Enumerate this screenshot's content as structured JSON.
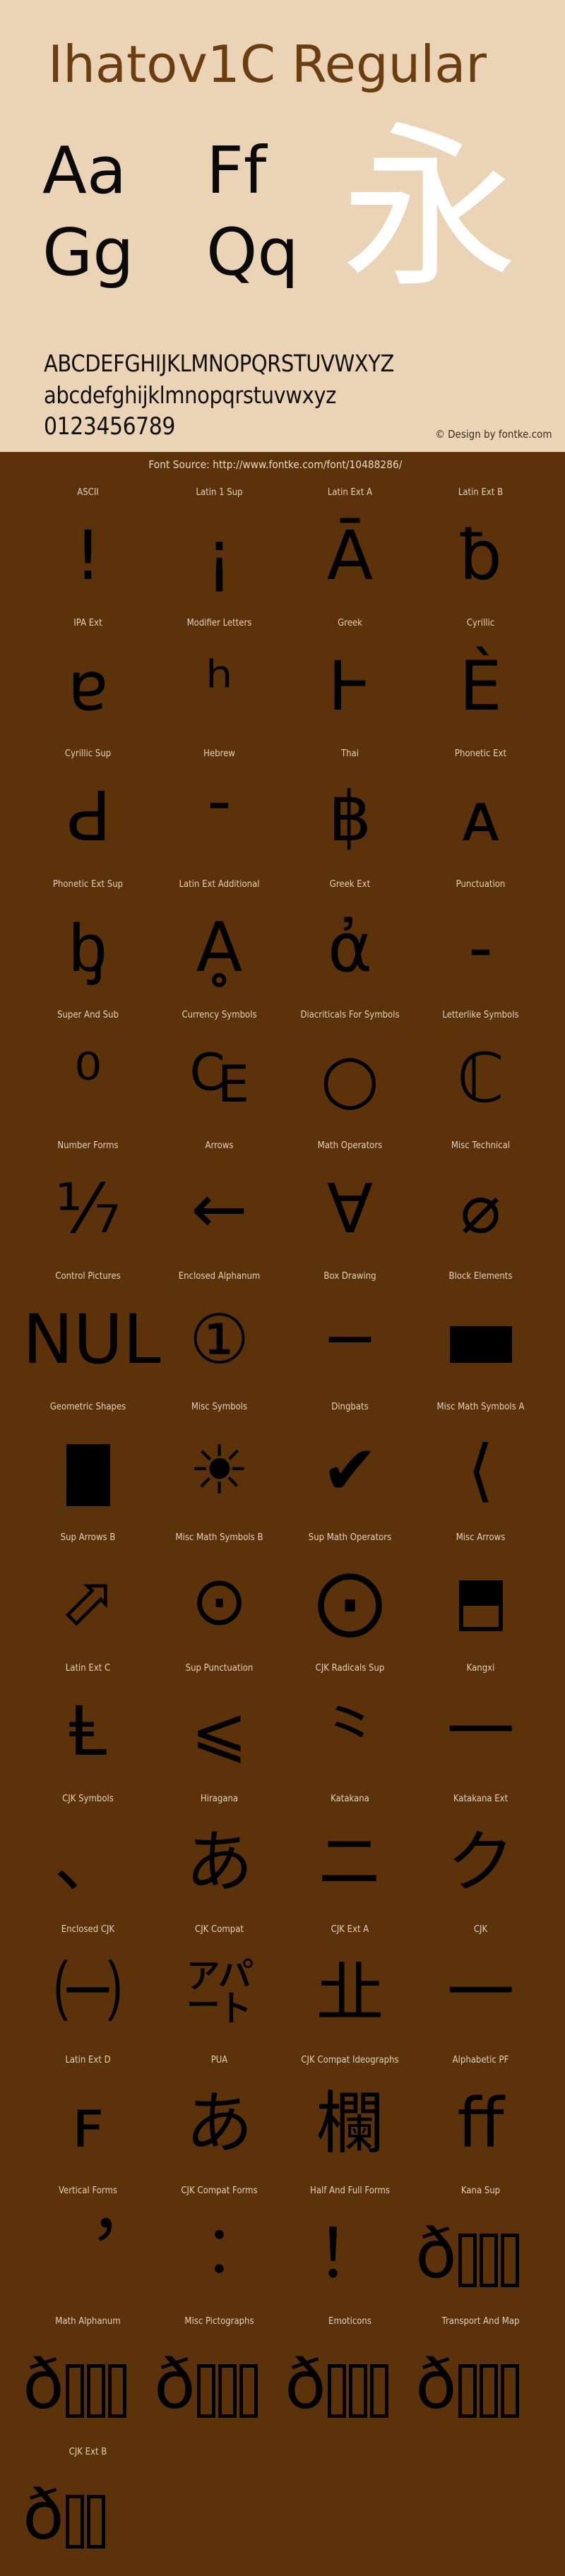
{
  "header": {
    "font_title": "Ihatov1C Regular",
    "sample_pairs": [
      "Aa",
      "Ff",
      "Gg",
      "Qq"
    ],
    "kanji_sample": "永",
    "alphabet_upper": "ABCDEFGHIJKLMNOPQRSTUVWXYZ",
    "alphabet_lower": "abcdefghijklmnopqrstuvwxyz",
    "digits": "0123456789",
    "credit": "© Design by fontke.com",
    "bg_color": "#ebd3b5",
    "title_color": "#6b3e12",
    "kanji_color": "#ffffff"
  },
  "source_line": "Font Source: http://www.fontke.com/font/10488286/",
  "page_bg_color": "#5b3209",
  "label_color": "#e3d2bd",
  "glyph_color": "#000000",
  "blocks": [
    {
      "label": "ASCII",
      "glyph": "!",
      "kind": "text"
    },
    {
      "label": "Latin 1 Sup",
      "glyph": "¡",
      "kind": "text"
    },
    {
      "label": "Latin Ext A",
      "glyph": "Ā",
      "kind": "text"
    },
    {
      "label": "Latin Ext B",
      "glyph": "ƀ",
      "kind": "text"
    },
    {
      "label": "IPA Ext",
      "glyph": "ɐ",
      "kind": "text"
    },
    {
      "label": "Modifier Letters",
      "glyph": "ʰ",
      "kind": "text"
    },
    {
      "label": "Greek",
      "glyph": "Ͱ",
      "kind": "text"
    },
    {
      "label": "Cyrillic",
      "glyph": "Ѐ",
      "kind": "text"
    },
    {
      "label": "Cyrillic Sup",
      "glyph": "Ԁ",
      "kind": "text"
    },
    {
      "label": "Hebrew",
      "glyph": "־",
      "kind": "text"
    },
    {
      "label": "Thai",
      "glyph": "฿",
      "kind": "text"
    },
    {
      "label": "Phonetic Ext",
      "glyph": "ᴀ",
      "kind": "text"
    },
    {
      "label": "Phonetic Ext Sup",
      "glyph": "ᶀ",
      "kind": "text"
    },
    {
      "label": "Latin Ext Additional",
      "glyph": "Ḁ",
      "kind": "text"
    },
    {
      "label": "Greek Ext",
      "glyph": "ἀ",
      "kind": "text"
    },
    {
      "label": "Punctuation",
      "glyph": "‐",
      "kind": "text"
    },
    {
      "label": "Super And Sub",
      "glyph": "⁰",
      "kind": "text"
    },
    {
      "label": "Currency Symbols",
      "glyph": "₠",
      "kind": "text"
    },
    {
      "label": "Diacriticals For Symbols",
      "glyph": "○",
      "kind": "text"
    },
    {
      "label": "Letterlike Symbols",
      "glyph": "ℂ",
      "kind": "text"
    },
    {
      "label": "Number Forms",
      "glyph": "⅐",
      "kind": "text"
    },
    {
      "label": "Arrows",
      "glyph": "←",
      "kind": "text"
    },
    {
      "label": "Math Operators",
      "glyph": "∀",
      "kind": "text"
    },
    {
      "label": "Misc Technical",
      "glyph": "⌀",
      "kind": "text"
    },
    {
      "label": "Control Pictures",
      "glyph": "NUL",
      "kind": "text"
    },
    {
      "label": "Enclosed Alphanum",
      "glyph": "①",
      "kind": "text"
    },
    {
      "label": "Box Drawing",
      "glyph": "─",
      "kind": "text"
    },
    {
      "label": "Block Elements",
      "glyph": "",
      "kind": "block-rect"
    },
    {
      "label": "Geometric Shapes",
      "glyph": "",
      "kind": "block-square"
    },
    {
      "label": "Misc Symbols",
      "glyph": "☀",
      "kind": "text"
    },
    {
      "label": "Dingbats",
      "glyph": "✔",
      "kind": "text"
    },
    {
      "label": "Misc Math Symbols A",
      "glyph": "⟨",
      "kind": "text"
    },
    {
      "label": "Sup Arrows B",
      "glyph": "⬀",
      "kind": "text"
    },
    {
      "label": "Misc Math Symbols B",
      "glyph": "⊙",
      "kind": "text"
    },
    {
      "label": "Sup Math Operators",
      "glyph": "⨀",
      "kind": "text"
    },
    {
      "label": "Misc Arrows",
      "glyph": "",
      "kind": "kangxi-box"
    },
    {
      "label": "Latin Ext C",
      "glyph": "Ⱡ",
      "kind": "text"
    },
    {
      "label": "Sup Punctuation",
      "glyph": "⩽",
      "kind": "text"
    },
    {
      "label": "CJK Radicals Sup",
      "glyph": "⺀",
      "kind": "text"
    },
    {
      "label": "Kangxi",
      "glyph": "⼀",
      "kind": "text"
    },
    {
      "label": "CJK Symbols",
      "glyph": "、",
      "kind": "text"
    },
    {
      "label": "Hiragana",
      "glyph": "あ",
      "kind": "text"
    },
    {
      "label": "Katakana",
      "glyph": "ニ",
      "kind": "text"
    },
    {
      "label": "Katakana Ext",
      "glyph": "ク",
      "kind": "text"
    },
    {
      "label": "Enclosed CJK",
      "glyph": "㈠",
      "kind": "text"
    },
    {
      "label": "CJK Compat",
      "glyph": "㌀",
      "kind": "text"
    },
    {
      "label": "CJK Ext A",
      "glyph": "㐀",
      "kind": "text"
    },
    {
      "label": "CJK",
      "glyph": "一",
      "kind": "text"
    },
    {
      "label": "Latin Ext D",
      "glyph": "ꜰ",
      "kind": "text"
    },
    {
      "label": "PUA",
      "glyph": "あ",
      "kind": "text"
    },
    {
      "label": "CJK Compat Ideographs",
      "glyph": "欄",
      "kind": "text"
    },
    {
      "label": "Alphabetic PF",
      "glyph": "ﬀ",
      "kind": "text"
    },
    {
      "label": "Vertical Forms",
      "glyph": "︐",
      "kind": "text"
    },
    {
      "label": "CJK Compat Forms",
      "glyph": "︰",
      "kind": "text"
    },
    {
      "label": "Half And Full Forms",
      "glyph": "！",
      "kind": "text"
    },
    {
      "label": "Kana Sup",
      "glyph": "ð",
      "kind": "tofu",
      "tofu_count": 3
    },
    {
      "label": "Math Alphanum",
      "glyph": "ð",
      "kind": "tofu",
      "tofu_count": 3
    },
    {
      "label": "Misc Pictographs",
      "glyph": "ð",
      "kind": "tofu",
      "tofu_count": 3
    },
    {
      "label": "Emoticons",
      "glyph": "ð",
      "kind": "tofu",
      "tofu_count": 3
    },
    {
      "label": "Transport And Map",
      "glyph": "ð",
      "kind": "tofu",
      "tofu_count": 3
    },
    {
      "label": "CJK Ext B",
      "glyph": "ð",
      "kind": "tofu",
      "tofu_count": 2
    }
  ]
}
